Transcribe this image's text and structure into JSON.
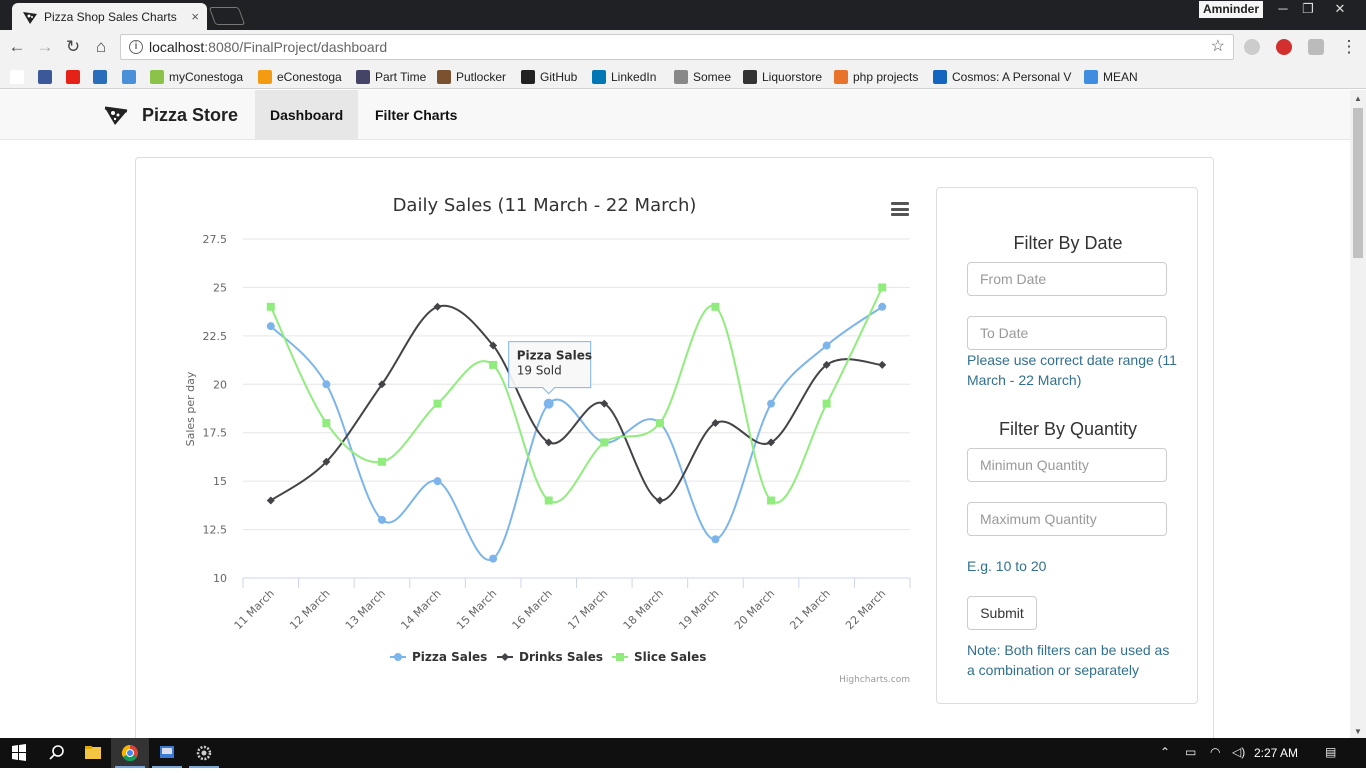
{
  "browser": {
    "tab_title": "Pizza Shop Sales Charts",
    "tab_close": "×",
    "profile": "Amninder",
    "url_host": "localhost",
    "url_path": ":8080/FinalProject/dashboard",
    "bookmarks": [
      {
        "label": "",
        "icon": "google-icon",
        "color": "#ffffff"
      },
      {
        "label": "",
        "icon": "facebook-icon",
        "color": "#3b5998"
      },
      {
        "label": "",
        "icon": "youtube-icon",
        "color": "#e62117"
      },
      {
        "label": "",
        "icon": "fr-icon",
        "color": "#2a6ebb"
      },
      {
        "label": "",
        "icon": "transfer-icon",
        "color": "#4a90d9"
      },
      {
        "label": "myConestoga",
        "icon": "myconestoga-icon",
        "color": "#8bc34a"
      },
      {
        "label": "eConestoga",
        "icon": "econestoga-icon",
        "color": "#f39c12"
      },
      {
        "label": "Part Time",
        "icon": "parttime-icon",
        "color": "#444466"
      },
      {
        "label": "Putlocker",
        "icon": "putlocker-icon",
        "color": "#7a5230"
      },
      {
        "label": "GitHub",
        "icon": "github-icon",
        "color": "#222222"
      },
      {
        "label": "LinkedIn",
        "icon": "linkedin-icon",
        "color": "#0077b5"
      },
      {
        "label": "Somee",
        "icon": "page-icon",
        "color": "#888888"
      },
      {
        "label": "Liquorstore",
        "icon": "bottle-icon",
        "color": "#333333"
      },
      {
        "label": "php projects",
        "icon": "php-icon",
        "color": "#e8742c"
      },
      {
        "label": "Cosmos: A Personal V",
        "icon": "cosmos-icon",
        "color": "#1565c0"
      },
      {
        "label": "MEAN",
        "icon": "mean-icon",
        "color": "#3f8de0"
      }
    ]
  },
  "navbar": {
    "brand": "Pizza Store",
    "links": [
      "Dashboard",
      "Filter Charts"
    ]
  },
  "filters": {
    "date_heading": "Filter By Date",
    "from_placeholder": "From Date",
    "to_placeholder": "To Date",
    "date_note": "Please use correct date range (11 March - 22 March)",
    "quantity_heading": "Filter By Quantity",
    "min_placeholder": "Minimun Quantity",
    "max_placeholder": "Maximum Quantity",
    "quantity_example": "E.g. 10 to 20",
    "submit_label": "Submit",
    "note": "Note: Both filters can be used as a combination or separately"
  },
  "taskbar": {
    "clock": "2:27 AM"
  },
  "chart_data": {
    "type": "line",
    "title": "Daily Sales (11 March - 22 March)",
    "xlabel": "",
    "ylabel": "Sales per day",
    "credits": "Highcharts.com",
    "categories": [
      "11 March",
      "12 March",
      "13 March",
      "14 March",
      "15 March",
      "16 March",
      "17 March",
      "18 March",
      "19 March",
      "20 March",
      "21 March",
      "22 March"
    ],
    "yticks": [
      "10",
      "12.5",
      "15",
      "17.5",
      "20",
      "22.5",
      "25",
      "27.5"
    ],
    "ylim": [
      10,
      27.5
    ],
    "grid": true,
    "legend_position": "bottom",
    "series": [
      {
        "name": "Pizza Sales",
        "color": "#7cb5ec",
        "marker": "circle",
        "values": [
          23,
          20,
          13,
          15,
          11,
          19,
          17,
          18,
          12,
          19,
          22,
          24
        ]
      },
      {
        "name": "Drinks Sales",
        "color": "#434348",
        "marker": "diamond",
        "values": [
          14,
          16,
          20,
          24,
          22,
          17,
          19,
          14,
          18,
          17,
          21,
          21
        ]
      },
      {
        "name": "Slice Sales",
        "color": "#90ed7d",
        "marker": "square",
        "values": [
          24,
          18,
          16,
          19,
          21,
          14,
          17,
          18,
          24,
          14,
          19,
          25
        ]
      }
    ],
    "tooltip": {
      "series": "Pizza Sales",
      "label": "19 Sold",
      "category_index": 5
    }
  }
}
